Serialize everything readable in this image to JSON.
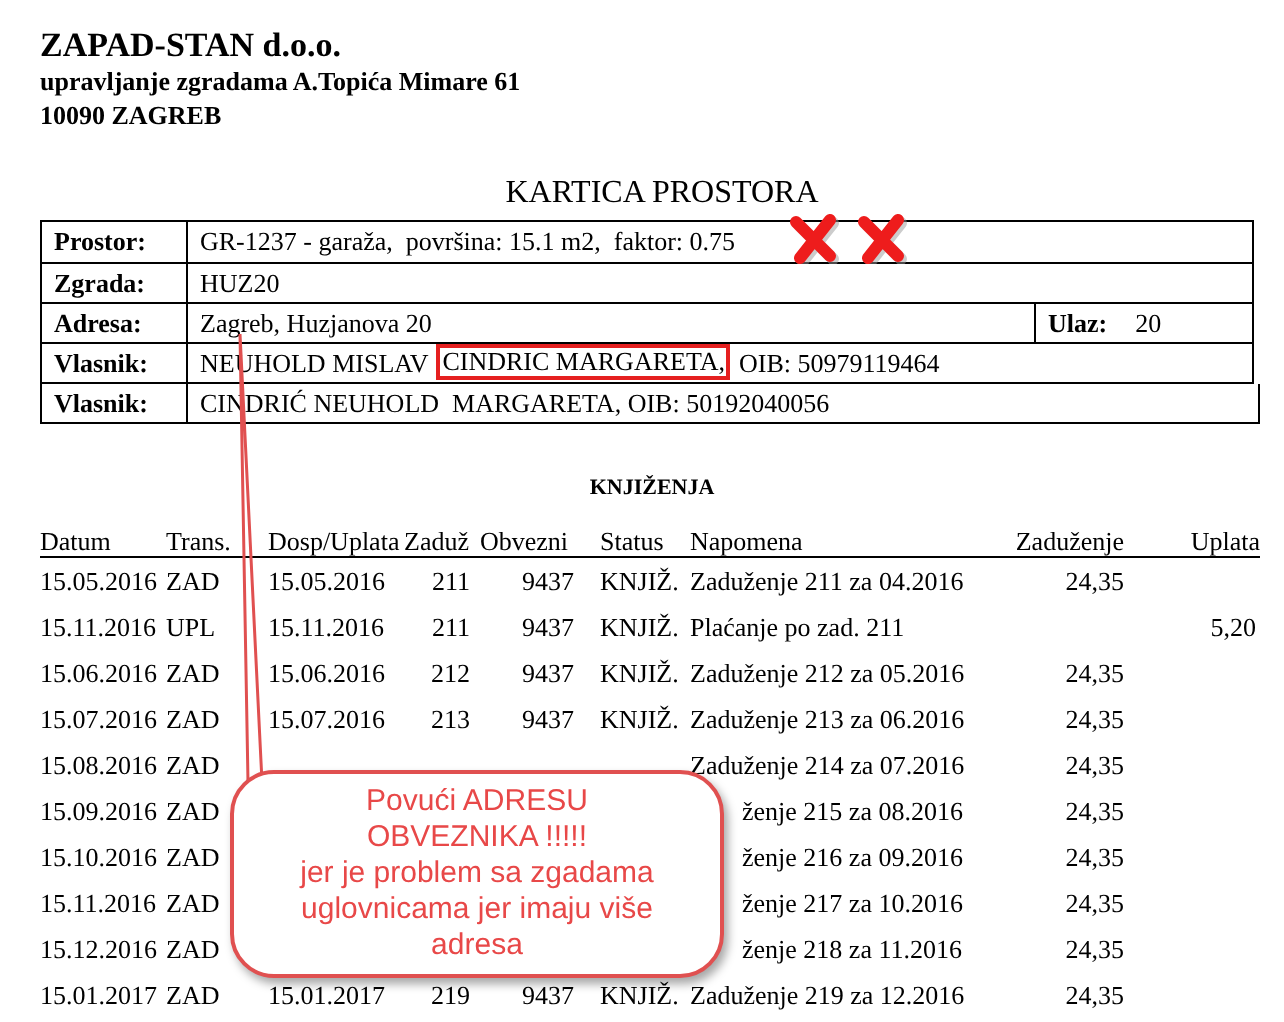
{
  "company": {
    "name": "ZAPAD-STAN d.o.o.",
    "address": "upravljanje zgradama A.Topića Mimare 61",
    "city": "10090 ZAGREB"
  },
  "title": "KARTICA PROSTORA",
  "info_rows": [
    {
      "label": "Prostor:",
      "parts": [
        {
          "text": "GR-1237 - garaža,  površina: 15.1 m2,  faktor: 0.75",
          "highlighted": false
        }
      ]
    },
    {
      "label": "Zgrada:",
      "parts": [
        {
          "text": "HUZ20",
          "highlighted": false
        }
      ]
    },
    {
      "label": "Adresa:",
      "parts": [
        {
          "text": "Zagreb, Huzjanova 20",
          "highlighted": false
        }
      ],
      "extra_label": "Ulaz:",
      "extra_value": "20"
    },
    {
      "label": "Vlasnik:",
      "parts": [
        {
          "text": "NEUHOLD MISLAV",
          "highlighted": false
        },
        {
          "text": "CINDRIC MARGARETA,",
          "highlighted": true
        },
        {
          "text": "OIB: 50979119464",
          "highlighted": false
        }
      ]
    }
  ],
  "owner_row": {
    "label": "Vlasnik:",
    "value": "CINDRIĆ NEUHOLD  MARGARETA, OIB: 50192040056"
  },
  "ledger": {
    "title": "KNJIŽENJA",
    "columns": [
      "Datum",
      "Trans.",
      "Dosp/Uplata",
      "Zaduž",
      "Obvezni",
      "Status",
      "Napomena",
      "Zaduženje",
      "Uplata"
    ],
    "rows": [
      {
        "datum": "15.05.2016",
        "trans": "ZAD",
        "dosp": "15.05.2016",
        "zaduz": "211",
        "obveznik": "9437",
        "status": "KNJIŽ.",
        "napomena": "Zaduženje 211 za 04.2016",
        "zaduzenje": "24,35"
      },
      {
        "datum": "15.11.2016",
        "trans": "UPL",
        "dosp": "15.11.2016",
        "zaduz": "211",
        "obveznik": "9437",
        "status": "KNJIŽ.",
        "napomena": "Plaćanje po zad. 211",
        "uplata": "5,20"
      },
      {
        "datum": "15.06.2016",
        "trans": "ZAD",
        "dosp": "15.06.2016",
        "zaduz": "212",
        "obveznik": "9437",
        "status": "KNJIŽ.",
        "napomena": "Zaduženje 212 za 05.2016",
        "zaduzenje": "24,35"
      },
      {
        "datum": "15.07.2016",
        "trans": "ZAD",
        "dosp": "15.07.2016",
        "zaduz": "213",
        "obveznik": "9437",
        "status": "KNJIŽ.",
        "napomena": "Zaduženje 213 za 06.2016",
        "zaduzenje": "24,35"
      },
      {
        "datum": "15.08.2016",
        "trans": "ZAD",
        "napomena": "Zaduženje 214 za 07.2016",
        "zaduzenje": "24,35"
      },
      {
        "kind": "covered",
        "datum": "15.09.2016",
        "trans": "ZAD",
        "napomena": "ženje 215 za 08.2016",
        "zaduzenje": "24,35"
      },
      {
        "kind": "covered",
        "datum": "15.10.2016",
        "trans": "ZAD",
        "napomena": "ženje 216 za 09.2016",
        "zaduzenje": "24,35"
      },
      {
        "kind": "covered",
        "datum": "15.11.2016",
        "trans": "ZAD",
        "napomena": "ženje 217 za 10.2016",
        "zaduzenje": "24,35"
      },
      {
        "kind": "covered",
        "datum": "15.12.2016",
        "trans": "ZAD",
        "napomena": "ženje 218 za 11.2016",
        "zaduzenje": "24,35"
      },
      {
        "datum": "15.01.2017",
        "trans": "ZAD",
        "dosp": "15.01.2017",
        "zaduz": "219",
        "obveznik": "9437",
        "status": "KNJIŽ.",
        "napomena": "Zaduženje 219 za 12.2016",
        "zaduzenje": "24,35"
      }
    ]
  },
  "callout": {
    "lines": [
      "Povući ADRESU",
      "OBVEZNIKA !!!!!",
      "jer je problem sa zgadama",
      "uglovnicama jer imaju više",
      "adresa"
    ]
  }
}
